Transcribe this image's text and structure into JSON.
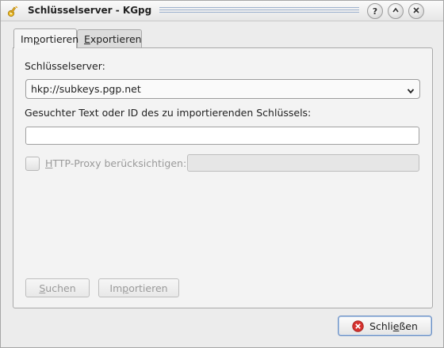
{
  "window": {
    "title": "Schlüsselserver - KGpg"
  },
  "titlebar": {
    "help_glyph": "?",
    "up_glyph": "^",
    "close_glyph": "×"
  },
  "tabs": [
    {
      "label_pre": "Im",
      "label_key": "p",
      "label_post": "ortieren",
      "active": true
    },
    {
      "label_pre": "",
      "label_key": "E",
      "label_post": "xportieren",
      "active": false
    }
  ],
  "import": {
    "server_label": "Schlüsselserver:",
    "server_value": "hkp://subkeys.pgp.net",
    "search_label": "Gesuchter Text oder ID des zu importierenden Schlüssels:",
    "search_value": "",
    "proxy_label_key": "H",
    "proxy_label_rest": "TTP-Proxy berücksichtigen:",
    "proxy_value": "",
    "search_button_key": "S",
    "search_button_rest": "uchen",
    "import_button_pre": "Im",
    "import_button_key": "p",
    "import_button_post": "ortieren"
  },
  "footer": {
    "close_pre": "Schli",
    "close_key": "e",
    "close_post": "ßen"
  },
  "colors": {
    "accent_focus": "#6a8fc4",
    "close_icon_red": "#d6322f"
  },
  "icons": {
    "app": "kgpg-key-icon",
    "close": "close-icon"
  }
}
